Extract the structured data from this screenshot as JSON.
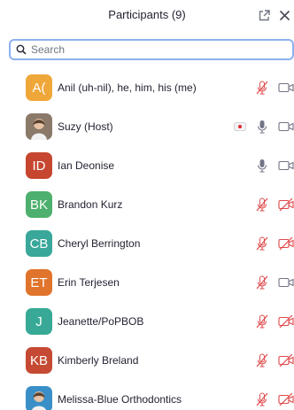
{
  "header": {
    "title": "Participants (9)",
    "popout_icon": "popout-icon",
    "close_icon": "close-icon"
  },
  "search": {
    "placeholder": "Search",
    "icon": "search-icon"
  },
  "colors": {
    "muted_red": "#e0494b",
    "icon_gray": "#747487",
    "search_border": "#8fb1ef"
  },
  "participants": [
    {
      "initials": "A(",
      "name": "Anil (uh-nil), he, him, his (me)",
      "avatar_color": "#f0a73a",
      "mic": "muted",
      "video": "on"
    },
    {
      "initials": "",
      "name": "Suzy (Host)",
      "avatar_color": "#8b7a6a",
      "avatar_photo": true,
      "sharing": true,
      "mic": "on",
      "video": "on"
    },
    {
      "initials": "ID",
      "name": "Ian Deonise",
      "avatar_color": "#c6462f",
      "mic": "on",
      "video": "on"
    },
    {
      "initials": "BK",
      "name": "Brandon Kurz",
      "avatar_color": "#4eb06e",
      "mic": "muted",
      "video": "off"
    },
    {
      "initials": "CB",
      "name": "Cheryl Berrington",
      "avatar_color": "#3aa79b",
      "mic": "muted",
      "video": "off"
    },
    {
      "initials": "ET",
      "name": "Erin Terjesen",
      "avatar_color": "#e0742c",
      "mic": "muted",
      "video": "on"
    },
    {
      "initials": "J",
      "name": "Jeanette/PoPBOB",
      "avatar_color": "#37a996",
      "mic": "muted",
      "video": "off"
    },
    {
      "initials": "KB",
      "name": "Kimberly Breland",
      "avatar_color": "#c64a33",
      "mic": "muted",
      "video": "off"
    },
    {
      "initials": "",
      "name": "Melissa-Blue Orthodontics",
      "avatar_color": "#3a8fc8",
      "avatar_photo": true,
      "mic": "muted",
      "video": "off"
    }
  ]
}
